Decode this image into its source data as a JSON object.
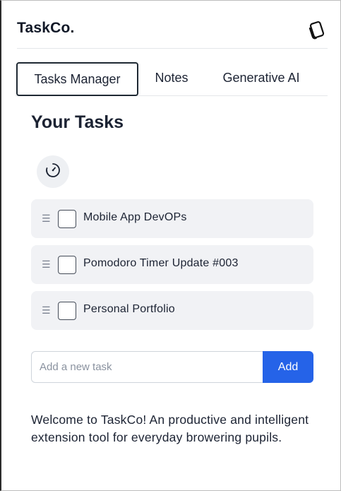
{
  "header": {
    "brand": "TaskCo.",
    "logo_icon": "tilted-card-icon"
  },
  "tabs": [
    {
      "label": "Tasks Manager",
      "active": true
    },
    {
      "label": "Notes",
      "active": false
    },
    {
      "label": "Generative AI",
      "active": false
    }
  ],
  "main": {
    "title": "Your Tasks",
    "refresh_icon": "timer-dial-icon",
    "tasks": [
      {
        "label": "Mobile App DevOPs",
        "done": false
      },
      {
        "label": "Pomodoro Timer Update #003",
        "done": false
      },
      {
        "label": "Personal Portfolio",
        "done": false
      }
    ],
    "new_task": {
      "value": "",
      "placeholder": "Add a new task"
    },
    "add_label": "Add",
    "welcome": "Welcome to TaskCo! An productive and intelligent extension tool for everyday browering pupils."
  },
  "colors": {
    "accent": "#2563e8",
    "task_bg": "#f1f2f5",
    "text": "#1c2333"
  }
}
